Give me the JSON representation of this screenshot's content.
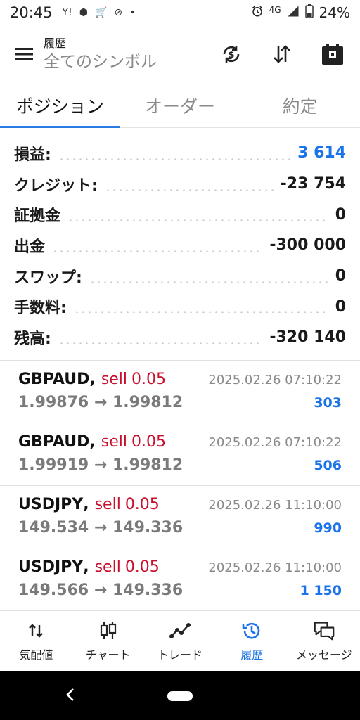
{
  "status": {
    "time": "20:45",
    "left_icons": [
      "Y!",
      "⬢",
      "🛒",
      "⊘",
      "•"
    ],
    "network": "4G",
    "battery": "24%"
  },
  "appbar": {
    "title_small": "履歴",
    "title_big": "全てのシンボル",
    "actions": [
      "sync-currency-icon",
      "sort-icon",
      "calendar-icon"
    ]
  },
  "tabs": [
    {
      "label": "ポジション",
      "active": true
    },
    {
      "label": "オーダー",
      "active": false
    },
    {
      "label": "約定",
      "active": false
    }
  ],
  "summary": [
    {
      "label": "損益:",
      "value": "3 614",
      "color": "#1a73e8"
    },
    {
      "label": "クレジット:",
      "value": "-23 754",
      "color": "#111111"
    },
    {
      "label": "証拠金",
      "value": "0",
      "color": "#111111"
    },
    {
      "label": "出金",
      "value": "-300 000",
      "color": "#111111"
    },
    {
      "label": "スワップ:",
      "value": "0",
      "color": "#111111"
    },
    {
      "label": "手数料:",
      "value": "0",
      "color": "#111111"
    },
    {
      "label": "残高:",
      "value": "-320 140",
      "color": "#111111"
    }
  ],
  "deals": [
    {
      "symbol": "GBPAUD",
      "side": "sell",
      "volume": "0.05",
      "time": "2025.02.26 07:10:22",
      "open": "1.99876",
      "close": "1.99812",
      "profit": "303"
    },
    {
      "symbol": "GBPAUD",
      "side": "sell",
      "volume": "0.05",
      "time": "2025.02.26 07:10:22",
      "open": "1.99919",
      "close": "1.99812",
      "profit": "506"
    },
    {
      "symbol": "USDJPY",
      "side": "sell",
      "volume": "0.05",
      "time": "2025.02.26 11:10:00",
      "open": "149.534",
      "close": "149.336",
      "profit": "990"
    },
    {
      "symbol": "USDJPY",
      "side": "sell",
      "volume": "0.05",
      "time": "2025.02.26 11:10:00",
      "open": "149.566",
      "close": "149.336",
      "profit": "1 150"
    }
  ],
  "bottomnav": [
    {
      "label": "気配値",
      "icon": "quotes-icon",
      "active": false
    },
    {
      "label": "チャート",
      "icon": "candlestick-icon",
      "active": false
    },
    {
      "label": "トレード",
      "icon": "trade-icon",
      "active": false
    },
    {
      "label": "履歴",
      "icon": "history-icon",
      "active": true
    },
    {
      "label": "メッセージ",
      "icon": "messages-icon",
      "active": false
    }
  ],
  "colors": {
    "accent": "#1a73e8",
    "sell": "#c8102e",
    "muted": "#8a8a8a"
  }
}
